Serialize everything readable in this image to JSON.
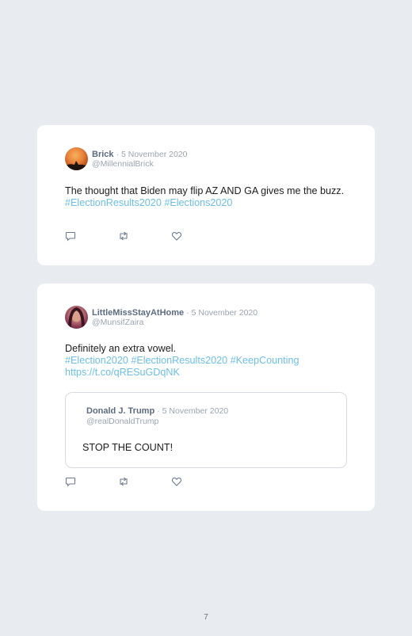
{
  "tweets": [
    {
      "name": "Brick",
      "date": "· 5 November 2020",
      "handle": "@MillennialBrick",
      "text": "The thought that Biden may flip AZ AND GA gives me the buzz.",
      "hashtags": "#ElectionResults2020 #Elections2020"
    },
    {
      "name": "LittleMissStayAtHome",
      "date": "· 5 November 2020",
      "handle": "@MunsifZaira",
      "text": "Definitely an extra vowel.",
      "hashtags": "#Election2020 #ElectionResults2020 #KeepCounting",
      "link": "https://t.co/qRESuGDqNK",
      "quote": {
        "name": "Donald J. Trump",
        "date": "· 5 November 2020",
        "handle": "@realDonaldTrump",
        "text": "STOP THE COUNT!"
      }
    }
  ],
  "icons": {
    "reply": "comment-icon",
    "retweet": "retweet-icon",
    "like": "heart-icon"
  },
  "colors": {
    "background": "#e8ebef",
    "card": "#ffffff",
    "link": "#6bbfe6",
    "name": "#5b6b80",
    "muted": "#9aa4b1"
  },
  "page_number": "7"
}
